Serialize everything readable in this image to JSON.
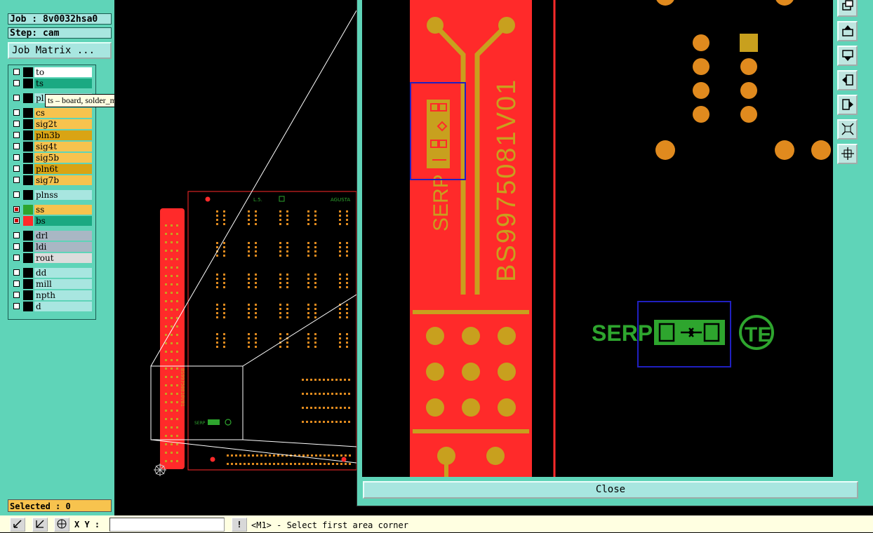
{
  "job_label": "Job : 8v0032hsa0",
  "step_label": "Step: cam",
  "job_matrix_button": "Job Matrix ...",
  "layers": [
    {
      "name": "to",
      "swatch": "#000000",
      "bg": "#ffffff",
      "checked": false
    },
    {
      "name": "ts",
      "swatch": "#000000",
      "bg": "#1aa982",
      "checked": false
    },
    {
      "name": "pl",
      "swatch": "#000000",
      "bg": "#a8e6e0",
      "checked": false
    },
    {
      "name": "cs",
      "swatch": "#000000",
      "bg": "#f7c34e",
      "checked": false
    },
    {
      "name": "sig2t",
      "swatch": "#000000",
      "bg": "#f7c34e",
      "checked": false
    },
    {
      "name": "pln3b",
      "swatch": "#000000",
      "bg": "#d9a414",
      "checked": false
    },
    {
      "name": "sig4t",
      "swatch": "#000000",
      "bg": "#f7c34e",
      "checked": false
    },
    {
      "name": "sig5b",
      "swatch": "#000000",
      "bg": "#f7c34e",
      "checked": false
    },
    {
      "name": "pln6t",
      "swatch": "#000000",
      "bg": "#d9a414",
      "checked": false
    },
    {
      "name": "sig7b",
      "swatch": "#000000",
      "bg": "#f7c34e",
      "checked": false
    },
    {
      "name": "plnss",
      "swatch": "#000000",
      "bg": "#a8e6e0",
      "checked": false
    },
    {
      "name": "ss",
      "swatch": "#2ea52e",
      "bg": "#f7c34e",
      "checked": true
    },
    {
      "name": "bs",
      "swatch": "#ff2a2a",
      "bg": "#1aa982",
      "checked": true
    },
    {
      "name": "drl",
      "swatch": "#000000",
      "bg": "#a9b7c4",
      "checked": false
    },
    {
      "name": "ldi",
      "swatch": "#000000",
      "bg": "#a9b7c4",
      "checked": false
    },
    {
      "name": "rout",
      "swatch": "#000000",
      "bg": "#dcdcdc",
      "checked": false
    },
    {
      "name": "dd",
      "swatch": "#000000",
      "bg": "#a8e6e0",
      "checked": false
    },
    {
      "name": "mill",
      "swatch": "#000000",
      "bg": "#a8e6e0",
      "checked": false
    },
    {
      "name": "npth",
      "swatch": "#000000",
      "bg": "#a8e6e0",
      "checked": false
    },
    {
      "name": "d",
      "swatch": "#000000",
      "bg": "#a8e6e0",
      "checked": false
    }
  ],
  "tooltip": "ts – board, solder_mask, positive",
  "selected_label": "Selected : 0",
  "xy_label": "X Y :",
  "xy_value": "",
  "prompt": "<M1> - Select first area corner",
  "close_button": "Close",
  "board": {
    "top_label": "L.5.",
    "brand_label": "AGUSTA",
    "vertical_text": "BS99750810V01",
    "serp_text": "SERP",
    "te_text": "TE",
    "part_code": "BS99750810V01"
  },
  "zoom": {
    "vertical_text": "BS9975081V01",
    "serp_vertical": "SERP",
    "serp_horizontal": "SERP",
    "te_text": "TE"
  },
  "colors": {
    "panel_bg": "#5fd4b8",
    "mask_red": "#ff2a2a",
    "pad_gold": "#c8a01e",
    "silk_green": "#2ea52e",
    "select_blue": "#2020c0"
  }
}
